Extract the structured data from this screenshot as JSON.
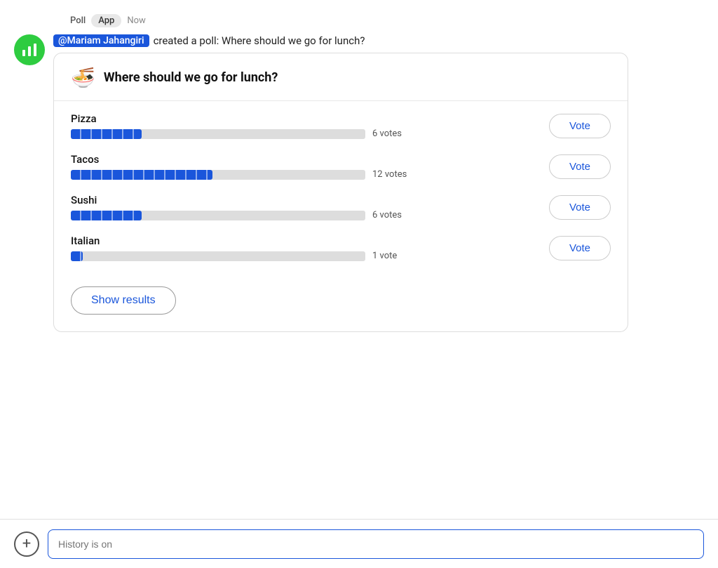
{
  "meta": {
    "label": "Poll",
    "tag": "App",
    "time": "Now"
  },
  "message": {
    "mention": "@Mariam Jahangiri",
    "text": "created a poll: Where should we go for lunch?"
  },
  "poll": {
    "emoji": "🍜",
    "title": "Where should we go for lunch?",
    "options": [
      {
        "id": 1,
        "label": "Pizza",
        "votes": 6,
        "vote_text": "6 votes",
        "pct": 24
      },
      {
        "id": 2,
        "label": "Tacos",
        "votes": 12,
        "vote_text": "12 votes",
        "pct": 48
      },
      {
        "id": 3,
        "label": "Sushi",
        "votes": 6,
        "vote_text": "6 votes",
        "pct": 24
      },
      {
        "id": 4,
        "label": "Italian",
        "votes": 1,
        "vote_text": "1 vote",
        "pct": 4
      }
    ],
    "vote_button_label": "Vote",
    "show_results_label": "Show results"
  },
  "bottom": {
    "placeholder": "History is on"
  }
}
